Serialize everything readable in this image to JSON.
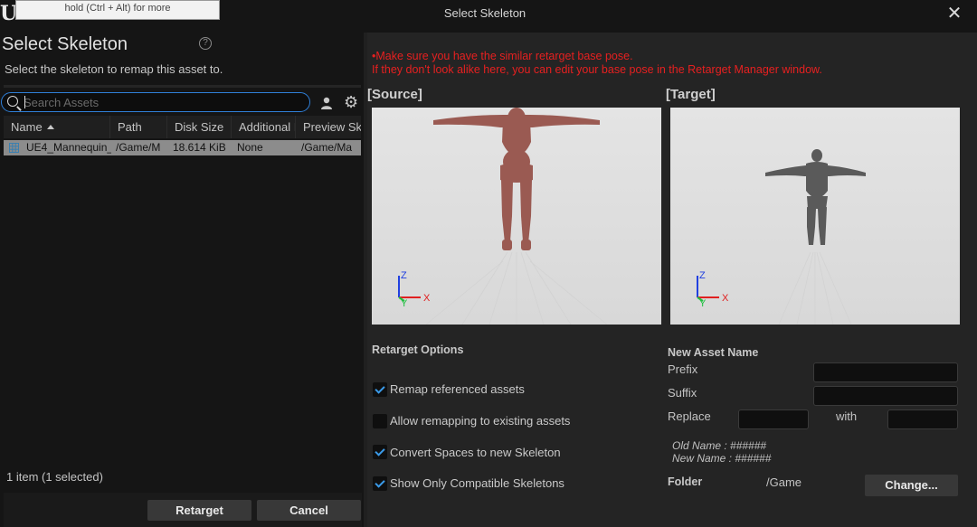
{
  "window": {
    "title": "Select Skeleton",
    "logo_text": "U",
    "tooltip": "hold (Ctrl + Alt) for more",
    "close_glyph": "✕"
  },
  "left": {
    "title": "Select Skeleton",
    "help_glyph": "?",
    "subtitle": "Select the skeleton to remap this asset to.",
    "search": {
      "placeholder": "Search Assets",
      "value": ""
    },
    "gear_glyph": "⚙",
    "columns": [
      "Name",
      "Path",
      "Disk Size",
      "Additional I",
      "Preview Sk"
    ],
    "rows": [
      {
        "name": "UE4_Mannequin_",
        "path": "/Game/M",
        "disk_size": "18.614 KiB",
        "additional": "None",
        "preview": "/Game/Ma",
        "selected": true
      }
    ],
    "item_count": "1 item (1 selected)",
    "buttons": {
      "retarget": "Retarget",
      "cancel": "Cancel"
    }
  },
  "right": {
    "warning_line1": "•Make sure you have the similar retarget base pose.",
    "warning_line2": "If they don't look alike here, you can edit your base pose in the Retarget Manager window.",
    "source_label": "[Source]",
    "target_label": "[Target]",
    "axes": {
      "z": "Z",
      "x": "X",
      "y": "Y"
    },
    "colors": {
      "source_mesh": "#9a5a52",
      "target_mesh": "#5a5a5a",
      "warning": "#e62020",
      "accent": "#2f7fd8"
    },
    "retarget_options": {
      "title": "Retarget Options",
      "options": [
        {
          "label": "Remap referenced assets",
          "checked": true
        },
        {
          "label": "Allow remapping to existing assets",
          "checked": false
        },
        {
          "label": "Convert Spaces to new Skeleton",
          "checked": true
        },
        {
          "label": "Show Only Compatible Skeletons",
          "checked": true
        }
      ]
    },
    "new_asset": {
      "title": "New Asset Name",
      "prefix_label": "Prefix",
      "prefix_value": "",
      "suffix_label": "Suffix",
      "suffix_value": "",
      "replace_label": "Replace",
      "replace_value": "",
      "with_label": "with",
      "with_value": "",
      "old_name": "Old Name : ######",
      "new_name": "New Name : ######"
    },
    "folder": {
      "label": "Folder",
      "value": "/Game",
      "change_button": "Change..."
    }
  }
}
